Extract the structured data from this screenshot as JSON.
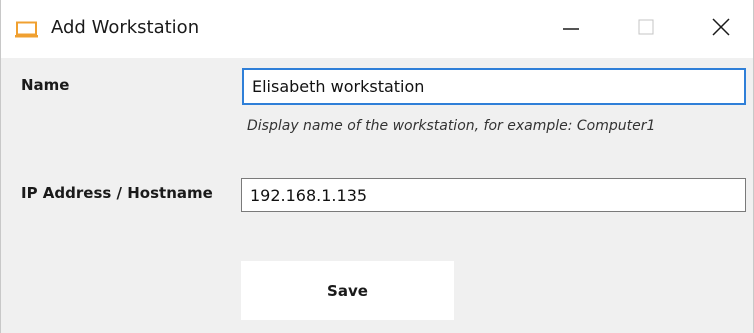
{
  "window": {
    "title": "Add Workstation",
    "icon": "laptop-icon",
    "controls": [
      "minimize-icon",
      "maximize-icon",
      "close-icon"
    ],
    "accent_color": "#f0a030"
  },
  "form": {
    "name": {
      "label": "Name",
      "value": "Elisabeth workstation",
      "hint": "Display name of the workstation, for example: Computer1"
    },
    "address": {
      "label": "IP Address / Hostname",
      "value": "192.168.1.135"
    },
    "save_label": "Save"
  }
}
